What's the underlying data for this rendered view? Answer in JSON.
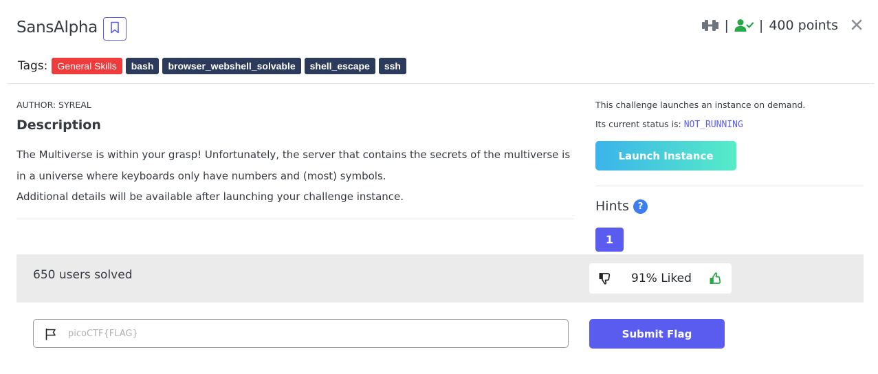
{
  "header": {
    "title": "SansAlpha",
    "points": "400 points",
    "separator": "|",
    "icons": [
      "bookmark-icon",
      "dumbbell-icon",
      "user-check-icon",
      "close-icon"
    ]
  },
  "tags": {
    "label": "Tags:",
    "items": [
      "General Skills",
      "bash",
      "browser_webshell_solvable",
      "shell_escape",
      "ssh"
    ]
  },
  "challenge": {
    "author": "AUTHOR: SYREAL",
    "description_heading": "Description",
    "description_line1": "The Multiverse is within your grasp! Unfortunately, the server that contains the secrets of the multiverse is in a universe where keyboards only have numbers and (most) symbols.",
    "description_line2": "Additional details will be available after launching your challenge instance."
  },
  "instance": {
    "info": "This challenge launches an instance on demand.",
    "status_label": "Its current status is:",
    "status_value": "NOT_RUNNING",
    "launch_label": "Launch Instance"
  },
  "hints": {
    "heading": "Hints",
    "help_symbol": "?",
    "items": [
      "1"
    ]
  },
  "stats": {
    "solved": "650 users solved",
    "liked": "91% Liked"
  },
  "flag": {
    "placeholder": "picoCTF{FLAG}",
    "submit_label": "Submit Flag"
  },
  "colors": {
    "accent": "#5a5cf0",
    "tag_dark": "#2c3a5b",
    "tag_red": "#ef3b3b",
    "success_green": "#28a745",
    "band_gray": "#ebebeb"
  }
}
